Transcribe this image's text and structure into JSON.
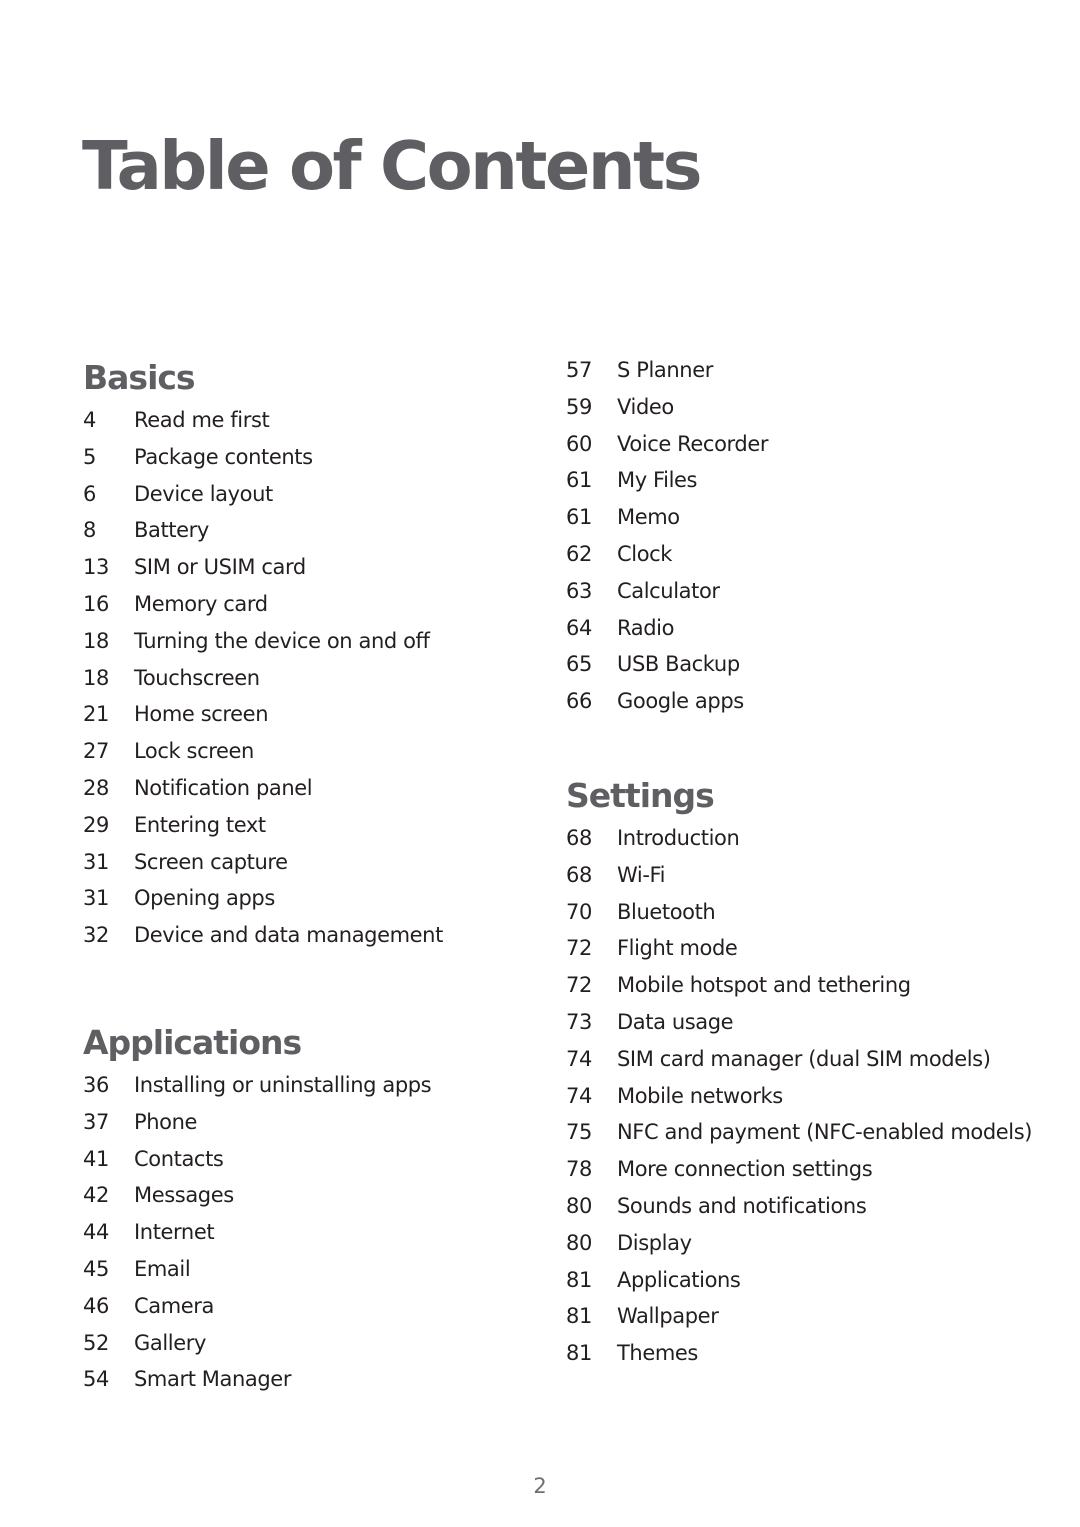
{
  "title": "Table of Contents",
  "page_number": "2",
  "sections": {
    "basics": {
      "heading": "Basics",
      "entries": [
        {
          "page": "4",
          "label": "Read me first"
        },
        {
          "page": "5",
          "label": "Package contents"
        },
        {
          "page": "6",
          "label": "Device layout"
        },
        {
          "page": "8",
          "label": "Battery"
        },
        {
          "page": "13",
          "label": "SIM or USIM card"
        },
        {
          "page": "16",
          "label": "Memory card"
        },
        {
          "page": "18",
          "label": "Turning the device on and off"
        },
        {
          "page": "18",
          "label": "Touchscreen"
        },
        {
          "page": "21",
          "label": "Home screen"
        },
        {
          "page": "27",
          "label": "Lock screen"
        },
        {
          "page": "28",
          "label": "Notification panel"
        },
        {
          "page": "29",
          "label": "Entering text"
        },
        {
          "page": "31",
          "label": "Screen capture"
        },
        {
          "page": "31",
          "label": "Opening apps"
        },
        {
          "page": "32",
          "label": "Device and data management"
        }
      ]
    },
    "applications": {
      "heading": "Applications",
      "entries": [
        {
          "page": "36",
          "label": "Installing or uninstalling apps"
        },
        {
          "page": "37",
          "label": "Phone"
        },
        {
          "page": "41",
          "label": "Contacts"
        },
        {
          "page": "42",
          "label": "Messages"
        },
        {
          "page": "44",
          "label": "Internet"
        },
        {
          "page": "45",
          "label": "Email"
        },
        {
          "page": "46",
          "label": "Camera"
        },
        {
          "page": "52",
          "label": "Gallery"
        },
        {
          "page": "54",
          "label": "Smart Manager"
        },
        {
          "page": "57",
          "label": "S Planner"
        },
        {
          "page": "59",
          "label": "Video"
        },
        {
          "page": "60",
          "label": "Voice Recorder"
        },
        {
          "page": "61",
          "label": "My Files"
        },
        {
          "page": "61",
          "label": "Memo"
        },
        {
          "page": "62",
          "label": "Clock"
        },
        {
          "page": "63",
          "label": "Calculator"
        },
        {
          "page": "64",
          "label": "Radio"
        },
        {
          "page": "65",
          "label": "USB Backup"
        },
        {
          "page": "66",
          "label": "Google apps"
        }
      ]
    },
    "settings": {
      "heading": "Settings",
      "entries": [
        {
          "page": "68",
          "label": "Introduction"
        },
        {
          "page": "68",
          "label": "Wi-Fi"
        },
        {
          "page": "70",
          "label": "Bluetooth"
        },
        {
          "page": "72",
          "label": "Flight mode"
        },
        {
          "page": "72",
          "label": "Mobile hotspot and tethering"
        },
        {
          "page": "73",
          "label": "Data usage"
        },
        {
          "page": "74",
          "label": "SIM card manager (dual SIM models)"
        },
        {
          "page": "74",
          "label": "Mobile networks"
        },
        {
          "page": "75",
          "label": "NFC and payment (NFC-enabled models)"
        },
        {
          "page": "78",
          "label": "More connection settings"
        },
        {
          "page": "80",
          "label": "Sounds and notifications"
        },
        {
          "page": "80",
          "label": "Display"
        },
        {
          "page": "81",
          "label": "Applications"
        },
        {
          "page": "81",
          "label": "Wallpaper"
        },
        {
          "page": "81",
          "label": "Themes"
        }
      ]
    }
  }
}
